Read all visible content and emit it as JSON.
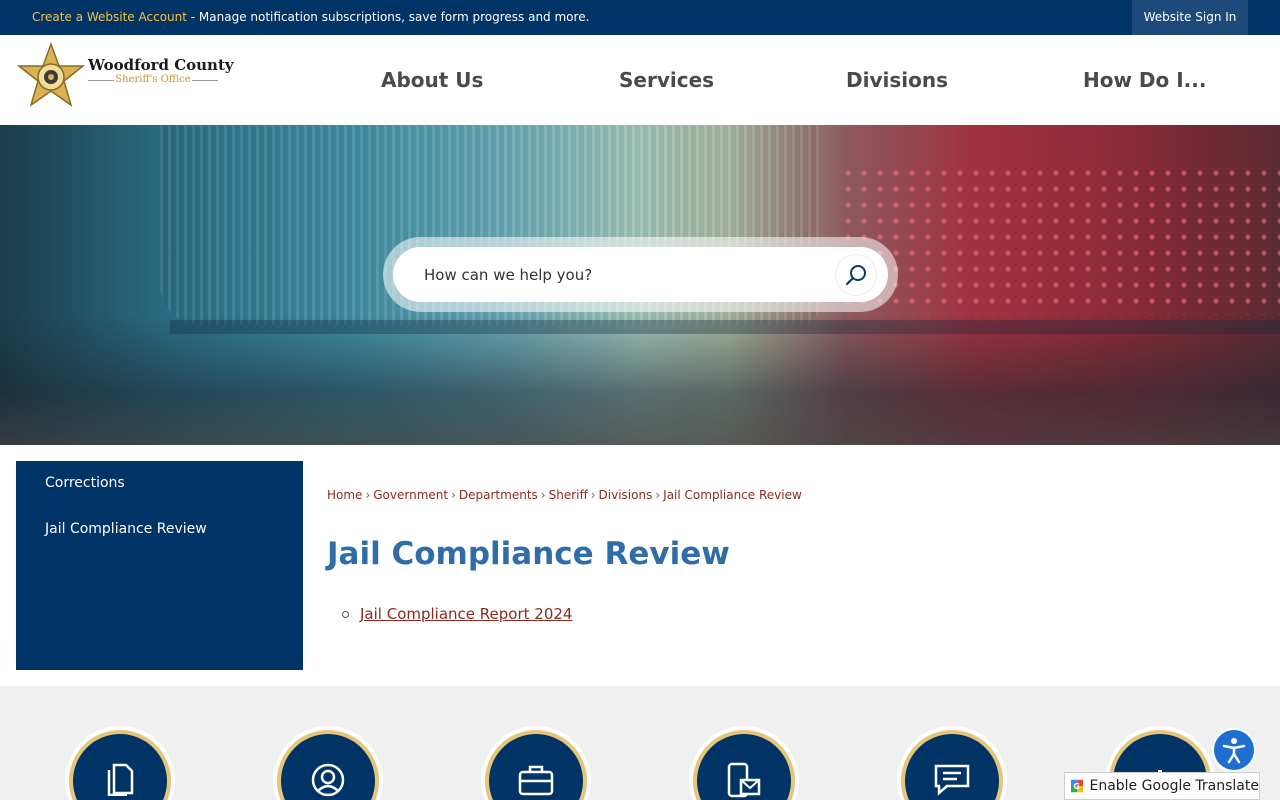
{
  "topbar": {
    "create_account_link": "Create a Website Account",
    "message": " - Manage notification subscriptions, save form progress and more.",
    "sign_in": "Website Sign In"
  },
  "logo": {
    "title": "Woodford County",
    "subtitle": "Sheriff's Office"
  },
  "nav": {
    "items": [
      {
        "label": "About Us"
      },
      {
        "label": "Services"
      },
      {
        "label": "Divisions"
      },
      {
        "label": "How Do I..."
      }
    ]
  },
  "search": {
    "placeholder": "How can we help you?"
  },
  "sidebar": {
    "items": [
      {
        "label": "Corrections"
      },
      {
        "label": "Jail Compliance Review"
      }
    ]
  },
  "breadcrumb": [
    "Home",
    "Government",
    "Departments",
    "Sheriff",
    "Divisions",
    "Jail Compliance Review"
  ],
  "page": {
    "title": "Jail Compliance Review",
    "documents": [
      {
        "label": "Jail Compliance Report 2024"
      }
    ]
  },
  "footer_icons": [
    "document-icon",
    "user-circle-icon",
    "briefcase-icon",
    "mobile-mail-icon",
    "chat-icon",
    "info-icon"
  ],
  "translate": {
    "label": "Enable Google Translate"
  },
  "colors": {
    "navy": "#003366",
    "gold": "#f5c04a",
    "title_blue": "#2f6ca8",
    "link_red": "#8b2b1f"
  }
}
